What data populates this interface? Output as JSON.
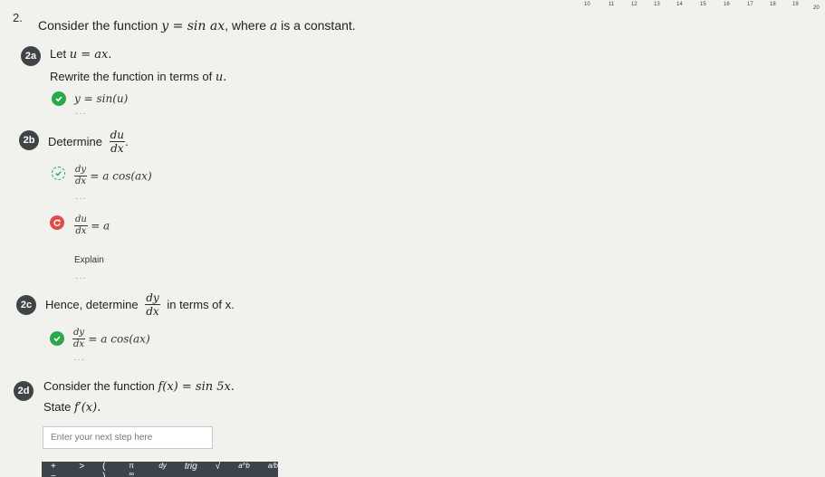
{
  "question": {
    "number": "2.",
    "text_pre": "Consider the function ",
    "eq": "y = sin ax",
    "text_mid": ", where ",
    "var": "a",
    "text_post": " is a constant."
  },
  "part_2a": {
    "badge": "2a",
    "let_pre": "Let ",
    "let_eq": "u = ax.",
    "rewrite_pre": "Rewrite the function in terms of ",
    "rewrite_var": "u.",
    "answer": "y = sin(u)"
  },
  "part_2b": {
    "badge": "2b",
    "label": "Determine",
    "frac_num": "du",
    "frac_den": "dx",
    "period": ".",
    "step1_num": "dy",
    "step1_den": "dx",
    "step1_rhs": "= a cos(ax)",
    "step2_num": "du",
    "step2_den": "dx",
    "step2_rhs": "= a",
    "explain": "Explain"
  },
  "part_2c": {
    "badge": "2c",
    "label": "Hence, determine",
    "frac_num": "dy",
    "frac_den": "dx",
    "suffix": "in terms of x.",
    "ans_num": "dy",
    "ans_den": "dx",
    "ans_rhs": "= a cos(ax)"
  },
  "part_2d": {
    "badge": "2d",
    "line1_pre": "Consider the function ",
    "line1_eq": "f(x) = sin 5x.",
    "line2_pre": "State ",
    "line2_eq": "f′(x).",
    "input_placeholder": "Enter your next step here"
  },
  "toolbar": {
    "items": [
      "+−",
      ">",
      "( )",
      "π ∞",
      "dy",
      "trig",
      "√",
      "a^b",
      "a/b"
    ]
  },
  "ruler": [
    "10",
    "11",
    "12",
    "13",
    "14",
    "15",
    "16",
    "17",
    "18",
    "19",
    "20"
  ],
  "ellipsis": "···",
  "colors": {
    "check": "#2aa84a",
    "retry": "#e24b4b",
    "badge": "#3f4447",
    "toolbar": "#3d4449"
  }
}
